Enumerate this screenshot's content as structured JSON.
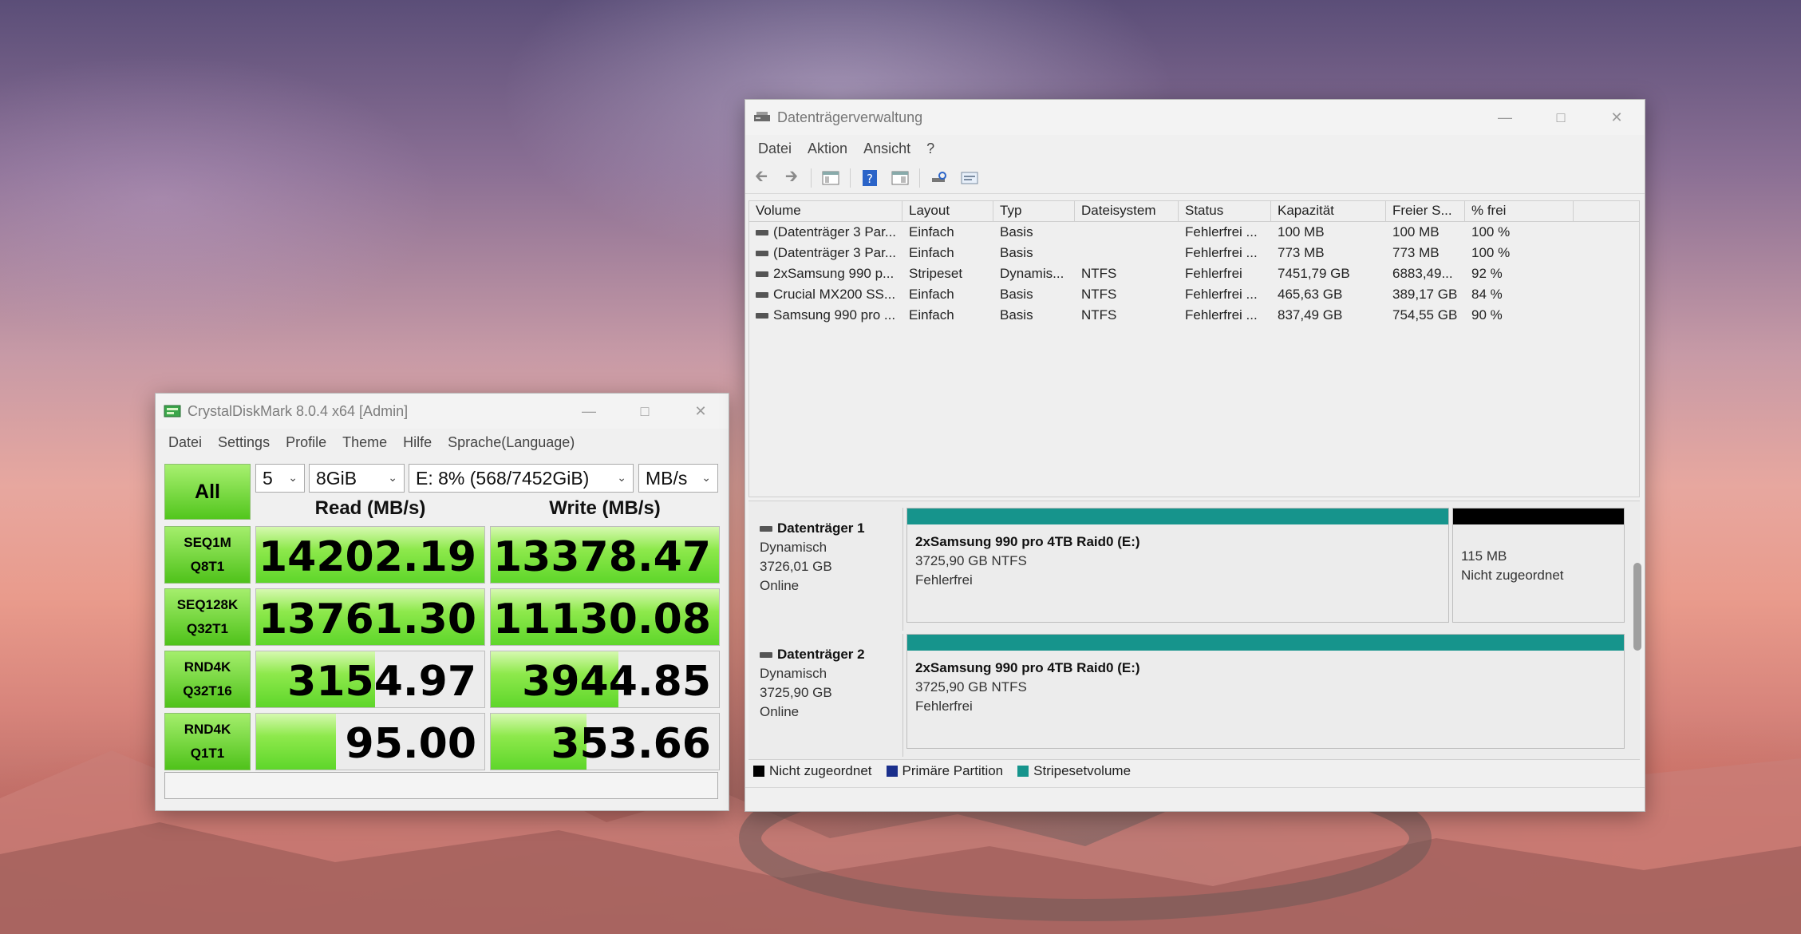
{
  "cdm": {
    "title": "CrystalDiskMark 8.0.4 x64 [Admin]",
    "menu": [
      "Datei",
      "Settings",
      "Profile",
      "Theme",
      "Hilfe",
      "Sprache(Language)"
    ],
    "all_label": "All",
    "count": "5",
    "size": "8GiB",
    "drive": "E: 8% (568/7452GiB)",
    "unit": "MB/s",
    "read_header": "Read (MB/s)",
    "write_header": "Write (MB/s)",
    "rows": [
      {
        "line1": "SEQ1M",
        "line2": "Q8T1",
        "read": "14202.19",
        "write": "13378.47",
        "read_fill": 1.0,
        "write_fill": 1.0
      },
      {
        "line1": "SEQ128K",
        "line2": "Q32T1",
        "read": "13761.30",
        "write": "11130.08",
        "read_fill": 1.0,
        "write_fill": 1.0
      },
      {
        "line1": "RND4K",
        "line2": "Q32T16",
        "read": "3154.97",
        "write": "3944.85",
        "read_fill": 0.52,
        "write_fill": 0.56
      },
      {
        "line1": "RND4K",
        "line2": "Q1T1",
        "read": "95.00",
        "write": "353.66",
        "read_fill": 0.35,
        "write_fill": 0.42
      }
    ],
    "comment": ""
  },
  "dm": {
    "title": "Datenträgerverwaltung",
    "menu": [
      "Datei",
      "Aktion",
      "Ansicht",
      "?"
    ],
    "columns": [
      "Volume",
      "Layout",
      "Typ",
      "Dateisystem",
      "Status",
      "Kapazität",
      "Freier S...",
      "% frei"
    ],
    "volumes": [
      [
        "(Datenträger 3 Par...",
        "Einfach",
        "Basis",
        "",
        "Fehlerfrei ...",
        "100 MB",
        "100 MB",
        "100 %"
      ],
      [
        "(Datenträger 3 Par...",
        "Einfach",
        "Basis",
        "",
        "Fehlerfrei ...",
        "773 MB",
        "773 MB",
        "100 %"
      ],
      [
        "2xSamsung 990 p...",
        "Stripeset",
        "Dynamis...",
        "NTFS",
        "Fehlerfrei",
        "7451,79 GB",
        "6883,49...",
        "92 %"
      ],
      [
        "Crucial MX200 SS...",
        "Einfach",
        "Basis",
        "NTFS",
        "Fehlerfrei ...",
        "465,63 GB",
        "389,17 GB",
        "84 %"
      ],
      [
        "Samsung 990 pro ...",
        "Einfach",
        "Basis",
        "NTFS",
        "Fehlerfrei ...",
        "837,49 GB",
        "754,55 GB",
        "90 %"
      ]
    ],
    "disks": [
      {
        "name": "Datenträger 1",
        "kind": "Dynamisch",
        "size": "3726,01 GB",
        "state": "Online",
        "part_name": "2xSamsung 990 pro 4TB Raid0   (E:)",
        "part_fs": "3725,90 GB NTFS",
        "part_status": "Fehlerfrei",
        "unalloc_size": "115 MB",
        "unalloc_label": "Nicht zugeordnet"
      },
      {
        "name": "Datenträger 2",
        "kind": "Dynamisch",
        "size": "3725,90 GB",
        "state": "Online",
        "part_name": "2xSamsung 990 pro 4TB Raid0   (E:)",
        "part_fs": "3725,90 GB NTFS",
        "part_status": "Fehlerfrei"
      }
    ],
    "legend": [
      "Nicht zugeordnet",
      "Primäre Partition",
      "Stripesetvolume"
    ]
  },
  "colors": {
    "unallocated": "#000000",
    "primary_partition": "#1a2f8c",
    "stripeset": "#16948c",
    "cdm_green": "#5ed62a"
  }
}
